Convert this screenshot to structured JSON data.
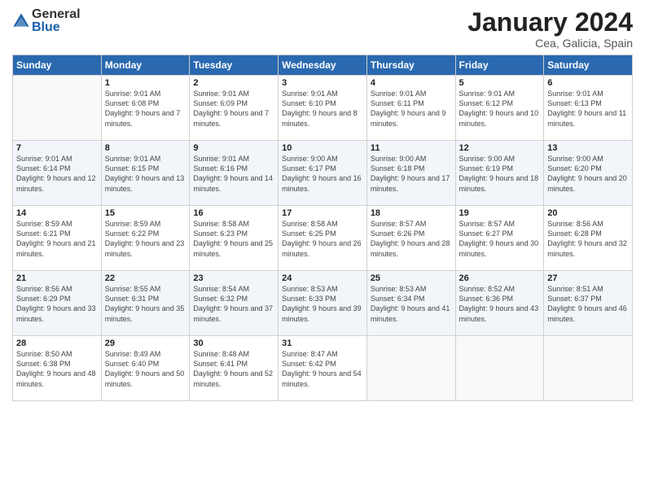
{
  "logo": {
    "general": "General",
    "blue": "Blue"
  },
  "title": "January 2024",
  "location": "Cea, Galicia, Spain",
  "columns": [
    "Sunday",
    "Monday",
    "Tuesday",
    "Wednesday",
    "Thursday",
    "Friday",
    "Saturday"
  ],
  "weeks": [
    [
      {
        "day": "",
        "sunrise": "",
        "sunset": "",
        "daylight": ""
      },
      {
        "day": "1",
        "sunrise": "Sunrise: 9:01 AM",
        "sunset": "Sunset: 6:08 PM",
        "daylight": "Daylight: 9 hours and 7 minutes."
      },
      {
        "day": "2",
        "sunrise": "Sunrise: 9:01 AM",
        "sunset": "Sunset: 6:09 PM",
        "daylight": "Daylight: 9 hours and 7 minutes."
      },
      {
        "day": "3",
        "sunrise": "Sunrise: 9:01 AM",
        "sunset": "Sunset: 6:10 PM",
        "daylight": "Daylight: 9 hours and 8 minutes."
      },
      {
        "day": "4",
        "sunrise": "Sunrise: 9:01 AM",
        "sunset": "Sunset: 6:11 PM",
        "daylight": "Daylight: 9 hours and 9 minutes."
      },
      {
        "day": "5",
        "sunrise": "Sunrise: 9:01 AM",
        "sunset": "Sunset: 6:12 PM",
        "daylight": "Daylight: 9 hours and 10 minutes."
      },
      {
        "day": "6",
        "sunrise": "Sunrise: 9:01 AM",
        "sunset": "Sunset: 6:13 PM",
        "daylight": "Daylight: 9 hours and 11 minutes."
      }
    ],
    [
      {
        "day": "7",
        "sunrise": "Sunrise: 9:01 AM",
        "sunset": "Sunset: 6:14 PM",
        "daylight": "Daylight: 9 hours and 12 minutes."
      },
      {
        "day": "8",
        "sunrise": "Sunrise: 9:01 AM",
        "sunset": "Sunset: 6:15 PM",
        "daylight": "Daylight: 9 hours and 13 minutes."
      },
      {
        "day": "9",
        "sunrise": "Sunrise: 9:01 AM",
        "sunset": "Sunset: 6:16 PM",
        "daylight": "Daylight: 9 hours and 14 minutes."
      },
      {
        "day": "10",
        "sunrise": "Sunrise: 9:00 AM",
        "sunset": "Sunset: 6:17 PM",
        "daylight": "Daylight: 9 hours and 16 minutes."
      },
      {
        "day": "11",
        "sunrise": "Sunrise: 9:00 AM",
        "sunset": "Sunset: 6:18 PM",
        "daylight": "Daylight: 9 hours and 17 minutes."
      },
      {
        "day": "12",
        "sunrise": "Sunrise: 9:00 AM",
        "sunset": "Sunset: 6:19 PM",
        "daylight": "Daylight: 9 hours and 18 minutes."
      },
      {
        "day": "13",
        "sunrise": "Sunrise: 9:00 AM",
        "sunset": "Sunset: 6:20 PM",
        "daylight": "Daylight: 9 hours and 20 minutes."
      }
    ],
    [
      {
        "day": "14",
        "sunrise": "Sunrise: 8:59 AM",
        "sunset": "Sunset: 6:21 PM",
        "daylight": "Daylight: 9 hours and 21 minutes."
      },
      {
        "day": "15",
        "sunrise": "Sunrise: 8:59 AM",
        "sunset": "Sunset: 6:22 PM",
        "daylight": "Daylight: 9 hours and 23 minutes."
      },
      {
        "day": "16",
        "sunrise": "Sunrise: 8:58 AM",
        "sunset": "Sunset: 6:23 PM",
        "daylight": "Daylight: 9 hours and 25 minutes."
      },
      {
        "day": "17",
        "sunrise": "Sunrise: 8:58 AM",
        "sunset": "Sunset: 6:25 PM",
        "daylight": "Daylight: 9 hours and 26 minutes."
      },
      {
        "day": "18",
        "sunrise": "Sunrise: 8:57 AM",
        "sunset": "Sunset: 6:26 PM",
        "daylight": "Daylight: 9 hours and 28 minutes."
      },
      {
        "day": "19",
        "sunrise": "Sunrise: 8:57 AM",
        "sunset": "Sunset: 6:27 PM",
        "daylight": "Daylight: 9 hours and 30 minutes."
      },
      {
        "day": "20",
        "sunrise": "Sunrise: 8:56 AM",
        "sunset": "Sunset: 6:28 PM",
        "daylight": "Daylight: 9 hours and 32 minutes."
      }
    ],
    [
      {
        "day": "21",
        "sunrise": "Sunrise: 8:56 AM",
        "sunset": "Sunset: 6:29 PM",
        "daylight": "Daylight: 9 hours and 33 minutes."
      },
      {
        "day": "22",
        "sunrise": "Sunrise: 8:55 AM",
        "sunset": "Sunset: 6:31 PM",
        "daylight": "Daylight: 9 hours and 35 minutes."
      },
      {
        "day": "23",
        "sunrise": "Sunrise: 8:54 AM",
        "sunset": "Sunset: 6:32 PM",
        "daylight": "Daylight: 9 hours and 37 minutes."
      },
      {
        "day": "24",
        "sunrise": "Sunrise: 8:53 AM",
        "sunset": "Sunset: 6:33 PM",
        "daylight": "Daylight: 9 hours and 39 minutes."
      },
      {
        "day": "25",
        "sunrise": "Sunrise: 8:53 AM",
        "sunset": "Sunset: 6:34 PM",
        "daylight": "Daylight: 9 hours and 41 minutes."
      },
      {
        "day": "26",
        "sunrise": "Sunrise: 8:52 AM",
        "sunset": "Sunset: 6:36 PM",
        "daylight": "Daylight: 9 hours and 43 minutes."
      },
      {
        "day": "27",
        "sunrise": "Sunrise: 8:51 AM",
        "sunset": "Sunset: 6:37 PM",
        "daylight": "Daylight: 9 hours and 46 minutes."
      }
    ],
    [
      {
        "day": "28",
        "sunrise": "Sunrise: 8:50 AM",
        "sunset": "Sunset: 6:38 PM",
        "daylight": "Daylight: 9 hours and 48 minutes."
      },
      {
        "day": "29",
        "sunrise": "Sunrise: 8:49 AM",
        "sunset": "Sunset: 6:40 PM",
        "daylight": "Daylight: 9 hours and 50 minutes."
      },
      {
        "day": "30",
        "sunrise": "Sunrise: 8:48 AM",
        "sunset": "Sunset: 6:41 PM",
        "daylight": "Daylight: 9 hours and 52 minutes."
      },
      {
        "day": "31",
        "sunrise": "Sunrise: 8:47 AM",
        "sunset": "Sunset: 6:42 PM",
        "daylight": "Daylight: 9 hours and 54 minutes."
      },
      {
        "day": "",
        "sunrise": "",
        "sunset": "",
        "daylight": ""
      },
      {
        "day": "",
        "sunrise": "",
        "sunset": "",
        "daylight": ""
      },
      {
        "day": "",
        "sunrise": "",
        "sunset": "",
        "daylight": ""
      }
    ]
  ]
}
